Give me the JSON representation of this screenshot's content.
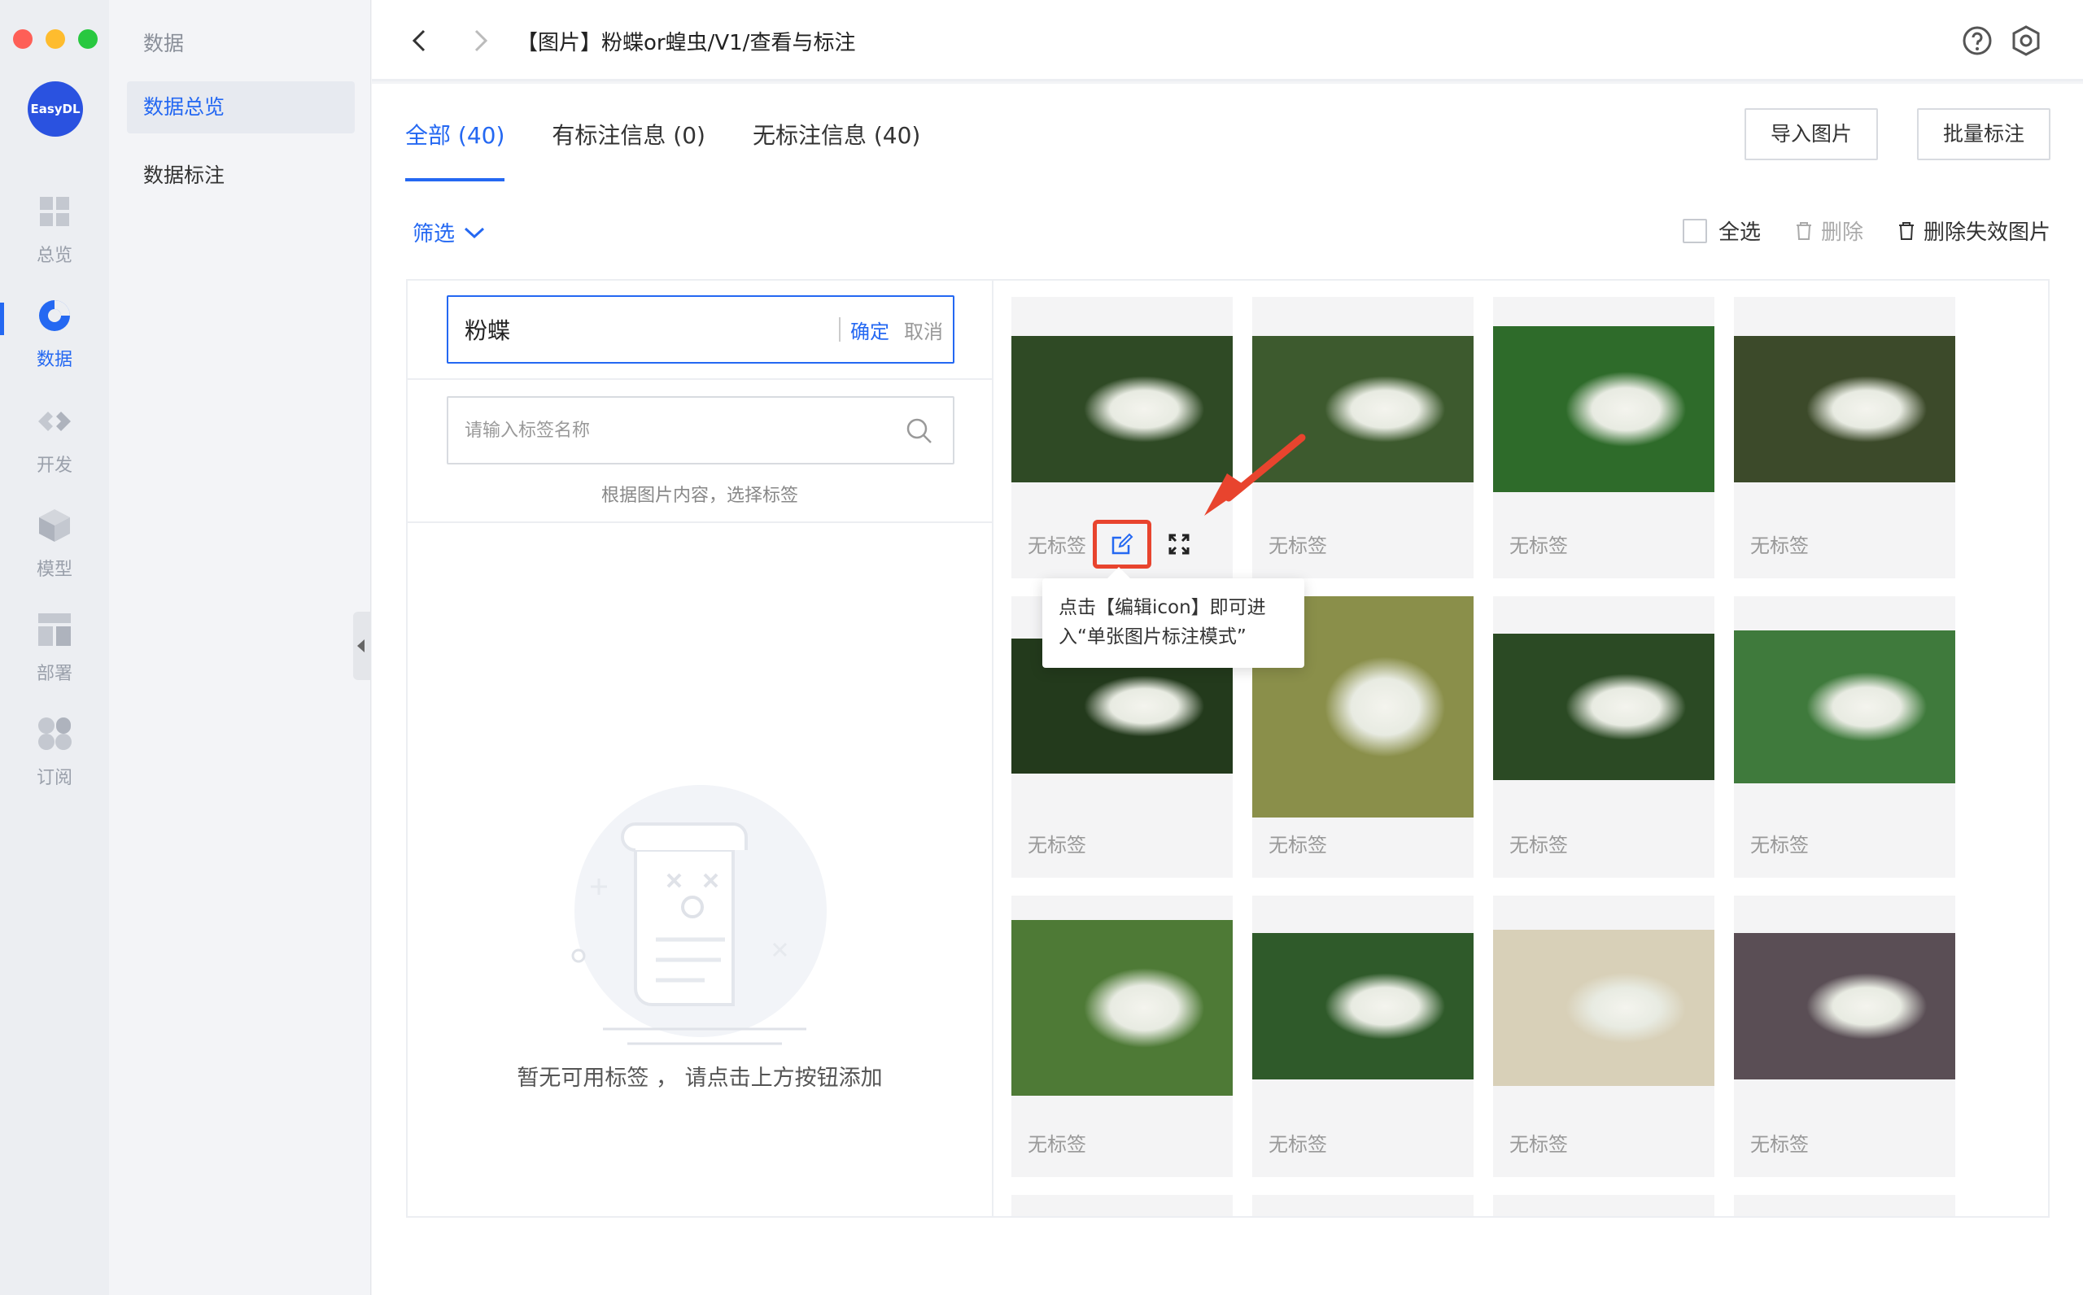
{
  "rail": {
    "logo": "EasyDL",
    "items": [
      {
        "label": "总览",
        "icon": "grid-icon"
      },
      {
        "label": "数据",
        "icon": "pie-chart-icon"
      },
      {
        "label": "开发",
        "icon": "code-icon"
      },
      {
        "label": "模型",
        "icon": "cube-icon"
      },
      {
        "label": "部署",
        "icon": "layout-icon"
      },
      {
        "label": "订阅",
        "icon": "apps-icon"
      }
    ],
    "active_index": 1
  },
  "subnav": {
    "title": "数据",
    "items": [
      {
        "label": "数据总览"
      },
      {
        "label": "数据标注"
      }
    ]
  },
  "topbar": {
    "breadcrumb": "【图片】粉蝶or蝗虫/V1/查看与标注"
  },
  "tabs": [
    {
      "label": "全部 (40)"
    },
    {
      "label": "有标注信息 (0)"
    },
    {
      "label": "无标注信息 (40)"
    }
  ],
  "actions": {
    "import": "导入图片",
    "batch": "批量标注"
  },
  "filter": {
    "label": "筛选"
  },
  "selection": {
    "select_all": "全选",
    "delete": "删除",
    "delete_invalid": "删除失效图片"
  },
  "label_panel": {
    "edit_value": "粉蝶",
    "confirm": "确定",
    "cancel": "取消",
    "search_placeholder": "请输入标签名称",
    "hint": "根据图片内容，选择标签",
    "empty_text": "暂无可用标签 ， 请点击上方按钮添加"
  },
  "tooltip": {
    "line1": "点击【编辑icon】即可进",
    "line2": "入“单张图片标注模式”"
  },
  "cards": [
    {
      "label": "无标签",
      "bg": "#2f4a25"
    },
    {
      "label": "无标签",
      "bg": "#3d5a2e"
    },
    {
      "label": "无标签",
      "bg": "#2e6b2a"
    },
    {
      "label": "无标签",
      "bg": "#3c4a2a"
    },
    {
      "label": "无标签",
      "bg": "#233a1c"
    },
    {
      "label": "无标签",
      "bg": "#8a8f4a"
    },
    {
      "label": "无标签",
      "bg": "#2b4a24"
    },
    {
      "label": "无标签",
      "bg": "#3f7a3c"
    },
    {
      "label": "无标签",
      "bg": "#4e7a36"
    },
    {
      "label": "无标签",
      "bg": "#2f5a2a"
    },
    {
      "label": "无标签",
      "bg": "#d8d0b8"
    },
    {
      "label": "无标签",
      "bg": "#5a4e55"
    }
  ],
  "colors": {
    "accent": "#2468f2",
    "highlight": "#e8442e"
  }
}
